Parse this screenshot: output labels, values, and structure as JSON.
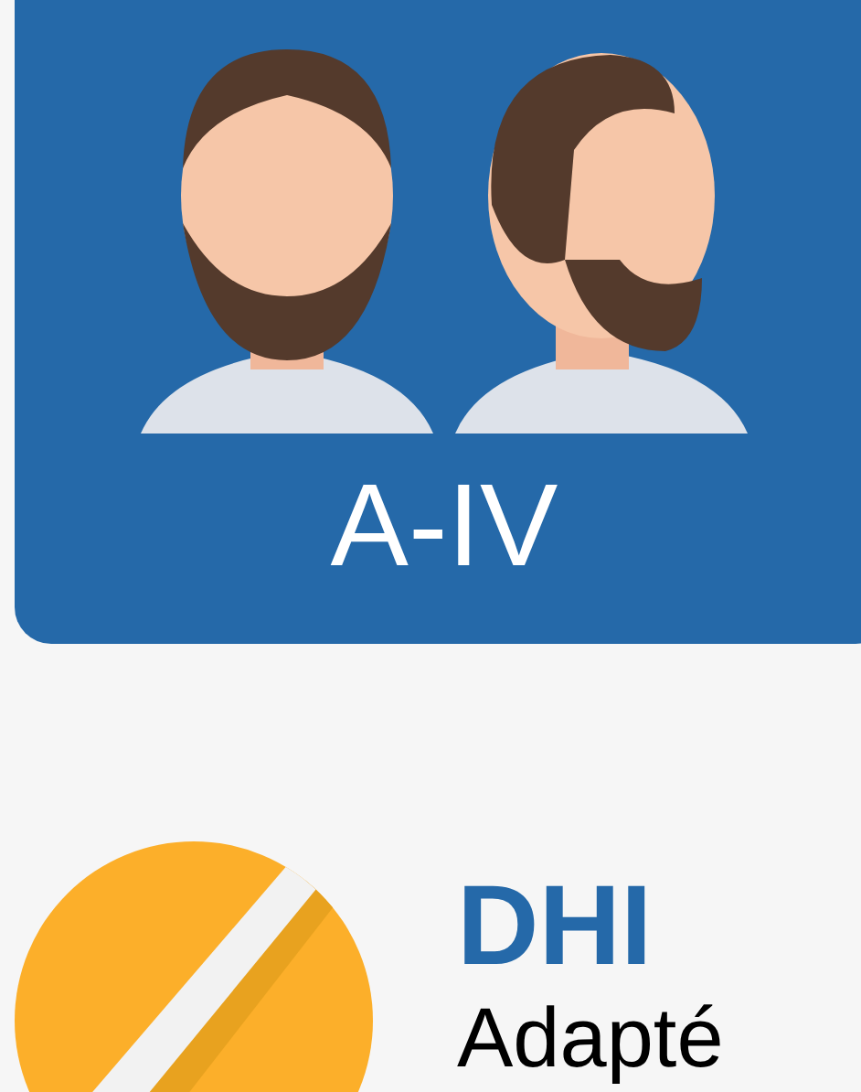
{
  "grade_card": {
    "label": "A-IV"
  },
  "technique": {
    "title": "DHI",
    "description": "Adapté"
  }
}
